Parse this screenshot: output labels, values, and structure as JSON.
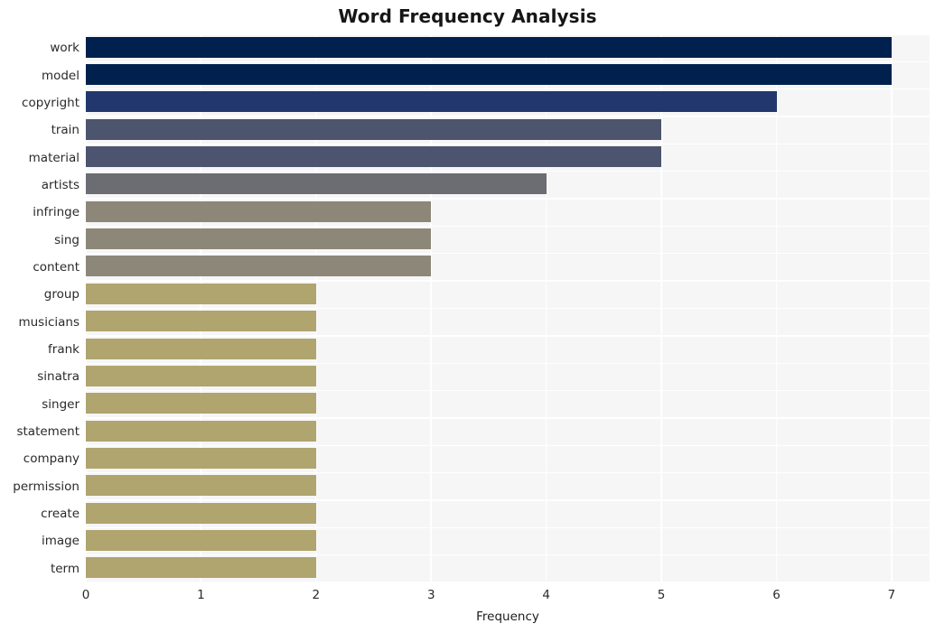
{
  "chart_data": {
    "type": "bar",
    "orientation": "horizontal",
    "title": "Word Frequency Analysis",
    "xlabel": "Frequency",
    "ylabel": "",
    "categories": [
      "work",
      "model",
      "copyright",
      "train",
      "material",
      "artists",
      "infringe",
      "sing",
      "content",
      "group",
      "musicians",
      "frank",
      "sinatra",
      "singer",
      "statement",
      "company",
      "permission",
      "create",
      "image",
      "term"
    ],
    "values": [
      7,
      7,
      6,
      5,
      5,
      4,
      3,
      3,
      3,
      2,
      2,
      2,
      2,
      2,
      2,
      2,
      2,
      2,
      2,
      2
    ],
    "bar_colors": [
      "#00214d",
      "#00214d",
      "#22376d",
      "#4d546d",
      "#4d5470",
      "#6b6d73",
      "#8c8778",
      "#8c8778",
      "#8c8778",
      "#b0a46f",
      "#b0a46f",
      "#b0a46f",
      "#b0a46f",
      "#b0a46f",
      "#b0a46f",
      "#b0a46f",
      "#b0a46f",
      "#b0a46f",
      "#b0a46f",
      "#b0a46f"
    ],
    "xlim": [
      0,
      7.33
    ],
    "xticks": [
      0,
      1,
      2,
      3,
      4,
      5,
      6,
      7
    ],
    "xtick_labels": [
      "0",
      "1",
      "2",
      "3",
      "4",
      "5",
      "6",
      "7"
    ],
    "grid": true,
    "grid_color": "#ffffff",
    "plot_background": "#f6f6f7",
    "figure_background": "#ffffff",
    "legend": null
  }
}
